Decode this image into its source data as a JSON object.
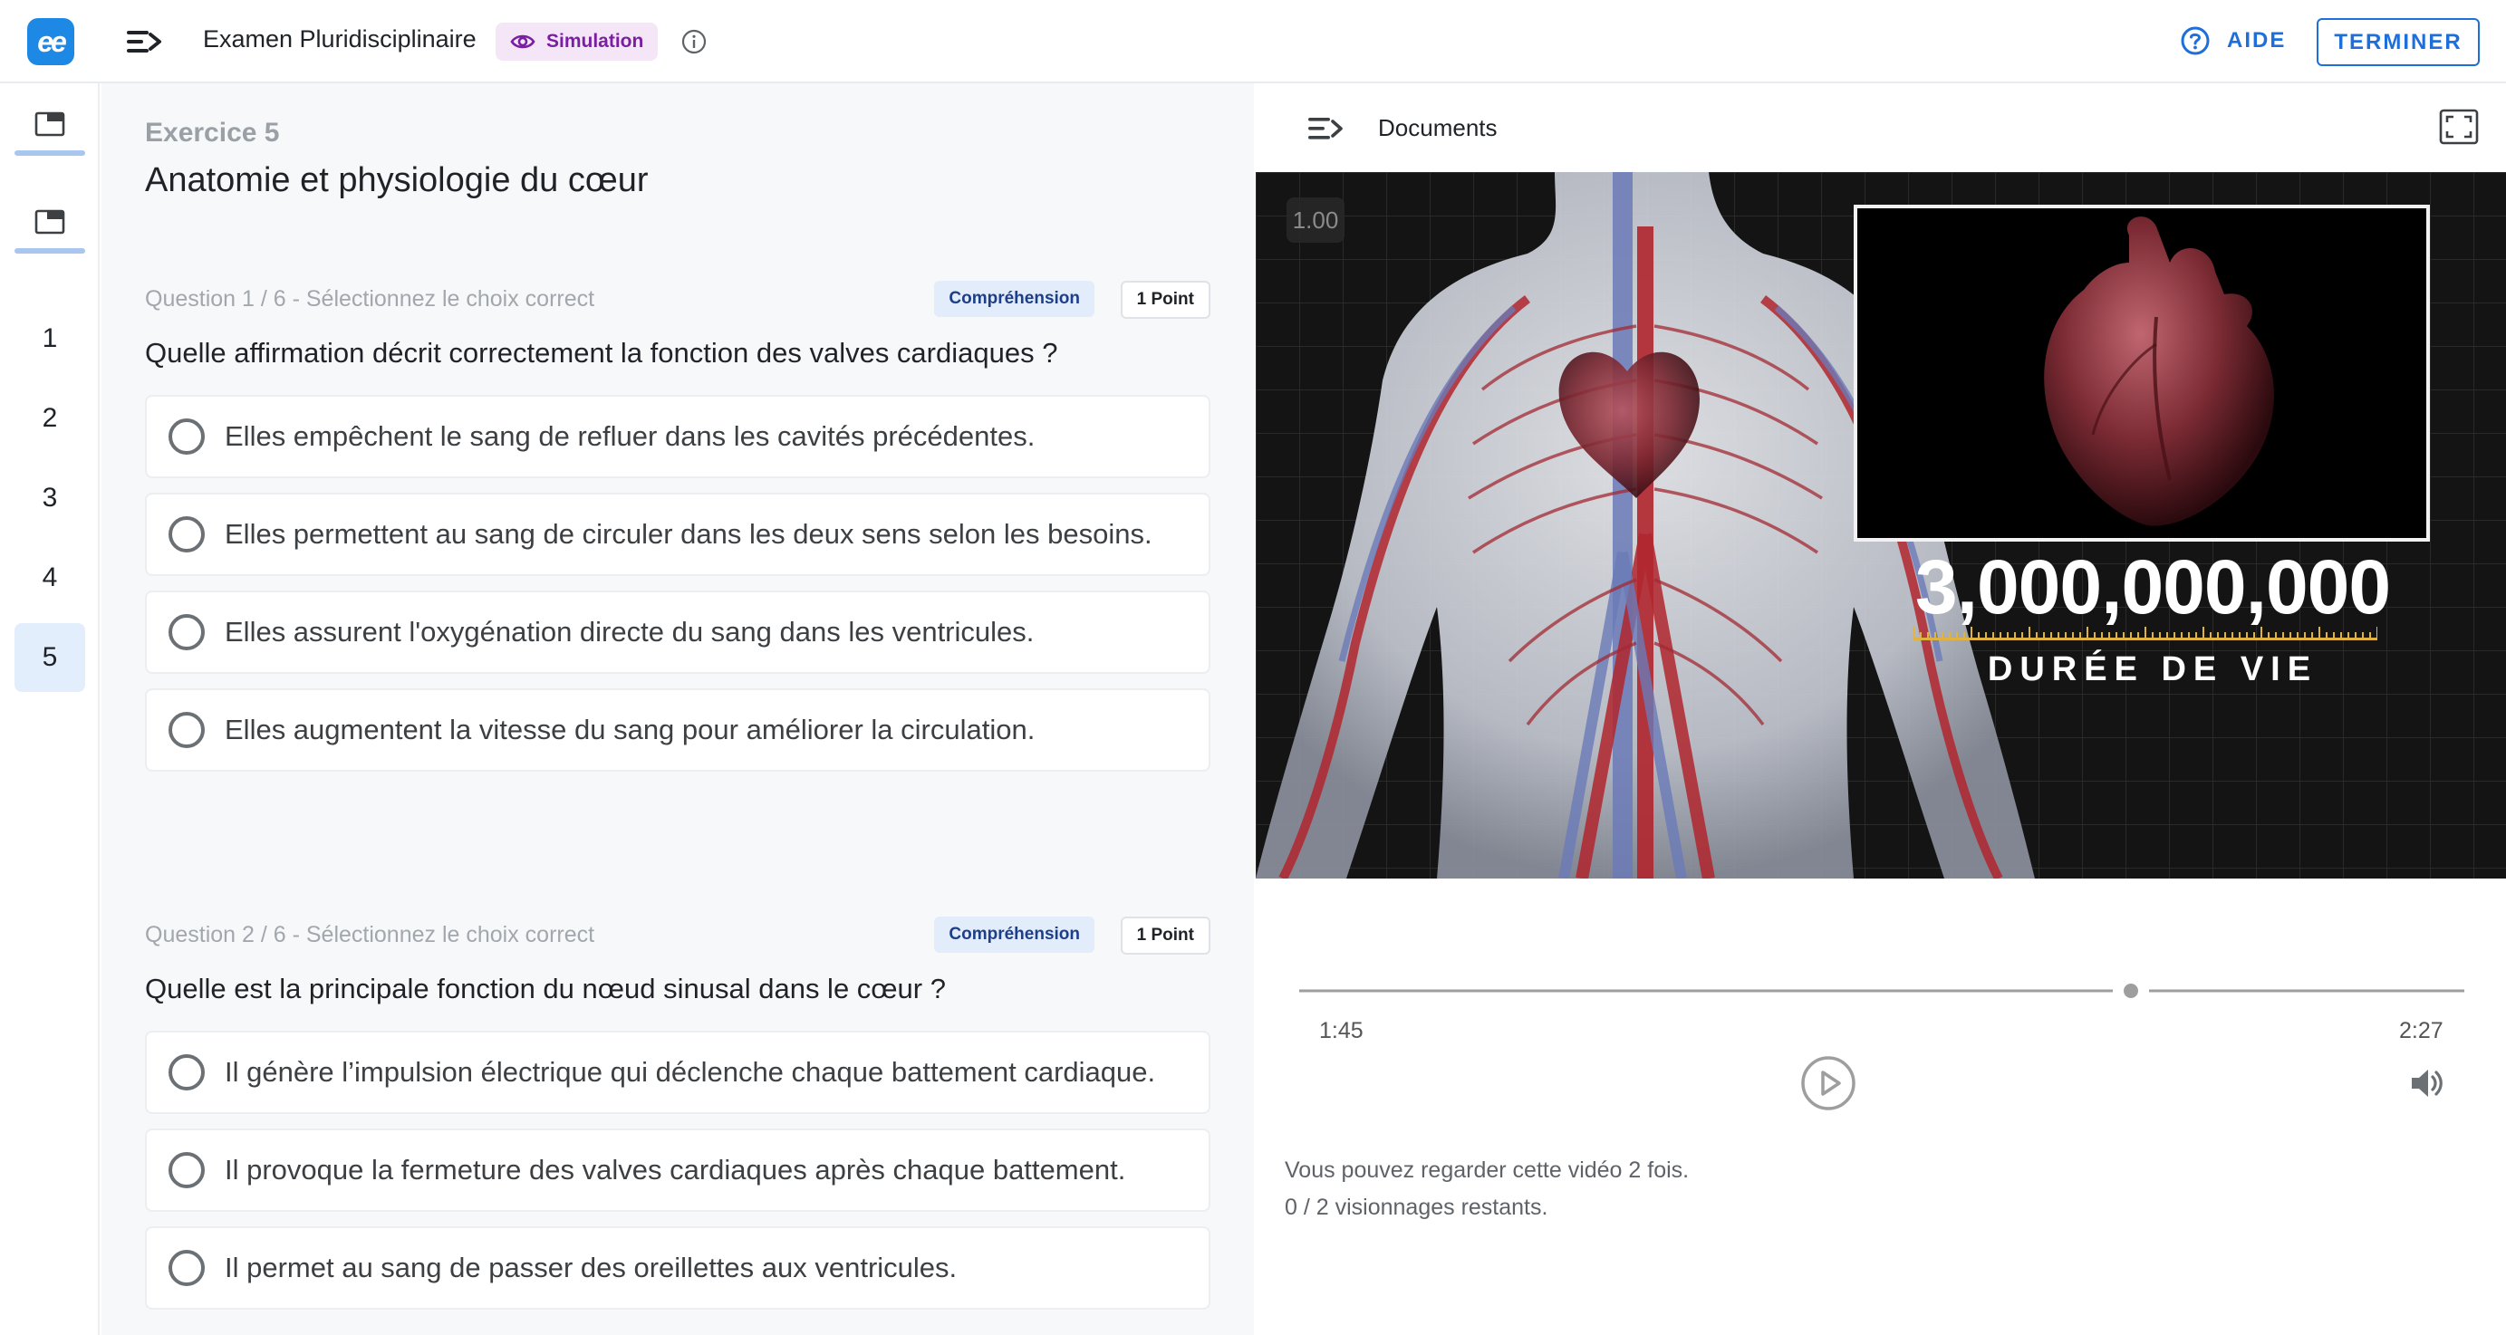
{
  "header": {
    "logo_text": "ee",
    "exam_title": "Examen Pluridisciplinaire",
    "mode_badge": "Simulation",
    "help_label": "AIDE",
    "finish_label": "TERMINER"
  },
  "rail": {
    "numbers": [
      "1",
      "2",
      "3",
      "4",
      "5"
    ],
    "active": "5"
  },
  "exercise": {
    "label": "Exercice 5",
    "title": "Anatomie et physiologie du cœur"
  },
  "questions": [
    {
      "label": "Question 1 / 6 - Sélectionnez le choix correct",
      "tag": "Compréhension",
      "points": "1 Point",
      "text": "Quelle affirmation décrit correctement la fonction des valves cardiaques ?",
      "options": [
        "Elles empêchent le sang de refluer dans les cavités précédentes.",
        "Elles permettent au sang de circuler dans les deux sens selon les besoins.",
        "Elles assurent l'oxygénation directe du sang dans les ventricules.",
        "Elles augmentent la vitesse du sang pour améliorer la circulation."
      ]
    },
    {
      "label": "Question 2 / 6 - Sélectionnez le choix correct",
      "tag": "Compréhension",
      "points": "1 Point",
      "text": "Quelle est la principale fonction du nœud sinusal dans le cœur ?",
      "options": [
        "Il génère l’impulsion électrique qui déclenche chaque battement cardiaque.",
        "Il provoque la fermeture des valves cardiaques après chaque battement.",
        "Il permet au sang de passer des oreillettes aux ventricules."
      ]
    }
  ],
  "documents": {
    "title": "Documents",
    "video": {
      "speed": "1.00",
      "overlay_number": "3,000,000,000",
      "overlay_caption": "DURÉE DE VIE",
      "current_time": "1:45",
      "total_time": "2:27",
      "progress_fraction": 0.714
    },
    "note_line1": "Vous pouvez regarder cette vidéo 2 fois.",
    "note_line2": "0 / 2 visionnages restants."
  },
  "colors": {
    "accent": "#1e6fd9",
    "badge_bg": "#f4e6f7",
    "badge_text": "#7b1fa2",
    "tag_bg": "#e3ecfa",
    "tag_text": "#1d3f8a"
  },
  "icons": [
    "logo-icon",
    "menu-toggle-icon",
    "eye-icon",
    "info-icon",
    "help-icon",
    "document-icon",
    "fullscreen-icon",
    "play-icon",
    "volume-icon"
  ]
}
